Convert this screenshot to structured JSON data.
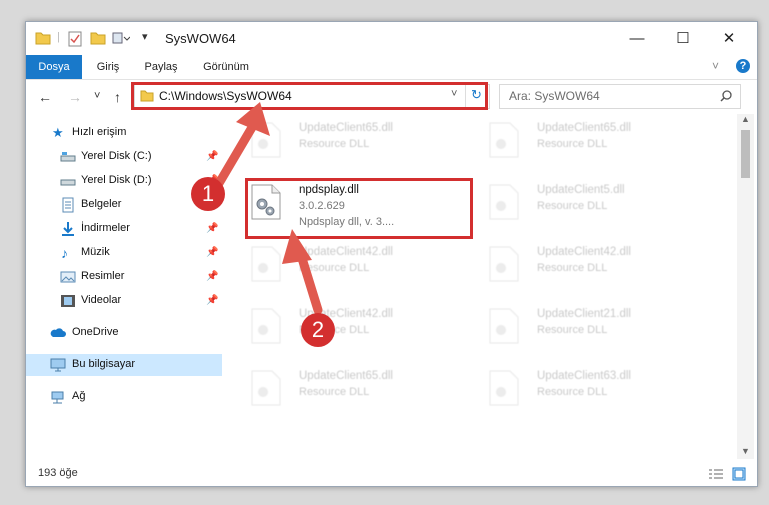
{
  "window": {
    "title": "SysWOW64",
    "minimize": "—",
    "maximize": "☐",
    "close": "✕"
  },
  "ribbon": {
    "tabs": [
      "Dosya",
      "Giriş",
      "Paylaş",
      "Görünüm"
    ]
  },
  "nav": {
    "back": "←",
    "forward": "→",
    "recent": "˅",
    "up": "↑",
    "address": "C:\\Windows\\SysWOW64",
    "search_placeholder": "Ara: SysWOW64"
  },
  "sidebar": {
    "items": [
      {
        "label": "Hızlı erişim",
        "icon": "star-icon"
      },
      {
        "label": "Yerel Disk (C:)",
        "icon": "drive-icon",
        "pinned": true
      },
      {
        "label": "Yerel Disk (D:)",
        "icon": "drive-icon",
        "pinned": true
      },
      {
        "label": "Belgeler",
        "icon": "document-icon",
        "pinned": true
      },
      {
        "label": "İndirmeler",
        "icon": "download-icon",
        "pinned": true
      },
      {
        "label": "Müzik",
        "icon": "music-icon",
        "pinned": true
      },
      {
        "label": "Resimler",
        "icon": "picture-icon",
        "pinned": true
      },
      {
        "label": "Videolar",
        "icon": "video-icon",
        "pinned": true
      },
      {
        "label": "OneDrive",
        "icon": "cloud-icon"
      },
      {
        "label": "Bu bilgisayar",
        "icon": "computer-icon",
        "selected": true
      },
      {
        "label": "Ağ",
        "icon": "network-icon"
      }
    ]
  },
  "files": {
    "left": [
      {
        "name": "UpdateClient65.dll",
        "type": "Resource DLL"
      },
      {
        "name": "npdsplay.dll",
        "version": "3.0.2.629",
        "desc": "Npdsplay dll, v. 3...."
      },
      {
        "name": "UpdateClient42.dll",
        "type": "Resource DLL"
      },
      {
        "name": "UpdateClient42.dll",
        "type": "Resource DLL"
      },
      {
        "name": "UpdateClient65.dll",
        "type": "Resource DLL"
      }
    ],
    "right": [
      {
        "name": "UpdateClient65.dll",
        "type": "Resource DLL"
      },
      {
        "name": "UpdateClient5.dll",
        "type": "Resource DLL"
      },
      {
        "name": "UpdateClient42.dll",
        "type": "Resource DLL"
      },
      {
        "name": "UpdateClient21.dll",
        "type": "Resource DLL"
      },
      {
        "name": "UpdateClient63.dll",
        "type": "Resource DLL"
      }
    ]
  },
  "status": {
    "count": "193 öğe"
  },
  "callouts": [
    "1",
    "2"
  ],
  "colors": {
    "accent": "#1979ca",
    "highlight": "#d32f2f",
    "selected": "#cce8ff"
  }
}
